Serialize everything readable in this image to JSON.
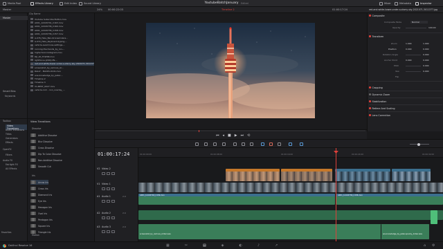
{
  "topbar": {
    "media_pool": "Media Pool",
    "effects_library": "Effects Library",
    "edit_index": "Edit Index",
    "sound_library": "Sound Library",
    "project_title": "YoutubeBatchJanuary",
    "edited": "Edited",
    "mixer": "Mixer",
    "metadata": "Metadata",
    "inspector": "Inspector"
  },
  "subbar": {
    "master": "Master",
    "zoom": "24%",
    "source_tc": "00:00:22:03",
    "timeline_name": "Timeline 2",
    "record_tc": "01:00:17:24",
    "clip_name": "red-and-white-tower-under-a-starry-sky-2021071-3011377.jpg"
  },
  "media_pool": {
    "left_items": [
      "Master",
      "Smart Bins",
      "Keywords"
    ],
    "header": "Clip Name",
    "clips": [
      "Youtube Subscribe Button.mov",
      "A001_12220741_C163.mov",
      "A001_12220736_C160.mov",
      "A001_12220736_C158.mov",
      "A001_12220736_C157.mov",
      "A-076_Hale_Ban-Kroreski-Vera...",
      "A-072_Hale_Keyboard-typing-...",
      "vehicle-event-loss-settings-...",
      "running-the-trends_by_ion-...",
      "highschool-Instagram.mov",
      "DJI_20_TCWS8.mov",
      "lightfocus-[200]-VN-...",
      "red-and-white-tower-under-a-starry-sky-2021071-3011377.jpg",
      "screenshot_by_remove_Ar...",
      "RALLY - BACKS-0101.mov",
      "ans-knowledge_by_peter-...",
      "Timeline 2",
      "Timeline 3",
      "V1-BEST_0027.mov",
      "vehicle.com - non_overlay_..."
    ]
  },
  "effects": {
    "left_items": [
      "Toolbox",
      "Video Transitions",
      "Audio Transitions",
      "Titles",
      "Generators",
      "Effects",
      "OpenFX",
      "Filters",
      "Audio FX",
      "Fairlight FX",
      "AU Effects",
      "Favorites"
    ],
    "header": "Video Transitions",
    "categories": [
      "Dissolve",
      "Iris",
      "Motion"
    ],
    "dissolve_items": [
      "Additive Dissolve",
      "Blur Dissolve",
      "Cross Dissolve",
      "Dip To Color Dissolve",
      "Non-Additive Dissolve",
      "Smooth Cut"
    ],
    "iris_items": [
      "Arrow Iris",
      "Cross Iris",
      "Diamond Iris",
      "Eye Iris",
      "Hexagon Iris",
      "Oval Iris",
      "Pentagon Iris",
      "Square Iris",
      "Triangle Iris"
    ]
  },
  "inspector": {
    "composite": "Composite",
    "composite_mode_label": "Composite Mode",
    "composite_mode_value": "Normal",
    "opacity_label": "Opacity",
    "opacity_value": "100.00",
    "transform": "Transform",
    "zoom_label": "Zoom",
    "zoom_x": "1.000",
    "zoom_y": "1.000",
    "position_label": "Position",
    "position_x": "0.000",
    "position_y": "0.000",
    "rotation_label": "Rotation Angle",
    "rotation_value": "0.000",
    "anchor_label": "Anchor Point",
    "anchor_x": "0.000",
    "anchor_y": "0.000",
    "pitch_label": "Pitch",
    "pitch_value": "0.000",
    "yaw_label": "Yaw",
    "yaw_value": "0.000",
    "flip_label": "Flip",
    "sections": [
      "Cropping",
      "Dynamic Zoom",
      "Stabilization",
      "Retime And Scaling",
      "Lens Correction"
    ]
  },
  "timeline": {
    "timecode": "01:00:17:24",
    "ruler": [
      "01:00:00:00",
      "01:00:08:00",
      "01:00:16:00",
      "01:00:24:00",
      "01:00:32:00"
    ],
    "tracks": [
      {
        "id": "V2",
        "name": "Video 2"
      },
      {
        "id": "V1",
        "name": "Video 1"
      },
      {
        "id": "A1",
        "name": "Audio 1",
        "level": "2.0"
      },
      {
        "id": "A2",
        "name": "Audio 2",
        "level": "2.0"
      },
      {
        "id": "A3",
        "name": "Audio 3",
        "level": "2.0"
      }
    ],
    "clip_v1": "A001_12220740_C156.mov",
    "clip_v1b": "A001_12220736_C158.mov",
    "clip_a3": "screenshot_by_remove_Ar4ier.wav",
    "clip_a3b": "ans-knowledge_by_peter-spooky_Ar4ier.wav"
  },
  "status": {
    "app": "DaVinci Resolve 16"
  },
  "colors": {
    "accent_red": "#e0403a",
    "playhead": "#e0403a",
    "video_clip": "#3b6f8e",
    "audio_clip": "#3a7e59",
    "title_clip": "#c6782a"
  }
}
